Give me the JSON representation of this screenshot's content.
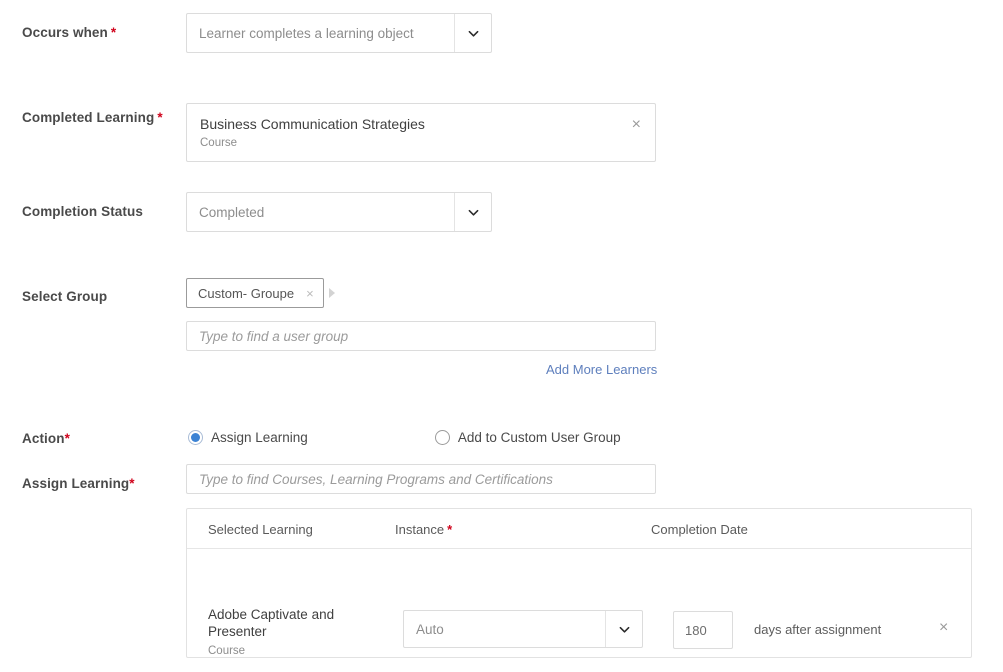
{
  "colors": {
    "required_asterisk": "#d0021b",
    "radio_selected": "#3b82d4",
    "link": "#5e7fbd",
    "label_text": "#4a4a4a",
    "placeholder_text": "#9b9b9b",
    "border": "#dcdcdc"
  },
  "fields": {
    "occurs_when": {
      "label": "Occurs when",
      "required_mark": "*",
      "value": "Learner completes a learning object"
    },
    "completed_learning": {
      "label": "Completed Learning",
      "required_mark": "*",
      "item_title": "Business Communication Strategies",
      "item_type": "Course",
      "remove_label": "×"
    },
    "completion_status": {
      "label": "Completion Status",
      "value": "Completed"
    },
    "select_group": {
      "label": "Select Group",
      "chip_label": "Custom- Groupe",
      "chip_remove_label": "×",
      "search_placeholder": "Type to find a user group",
      "add_more_link": "Add More Learners"
    },
    "action": {
      "label": "Action",
      "required_mark": "*",
      "options": [
        {
          "label": "Assign Learning",
          "selected": true
        },
        {
          "label": "Add to Custom User Group",
          "selected": false
        }
      ]
    },
    "assign_learning": {
      "label": "Assign Learning",
      "required_mark": "*",
      "search_placeholder": "Type to find Courses, Learning Programs and Certifications"
    }
  },
  "table": {
    "headers": [
      {
        "label": "Selected Learning",
        "required_mark": ""
      },
      {
        "label": "Instance",
        "required_mark": "*"
      },
      {
        "label": "Completion Date",
        "required_mark": ""
      }
    ],
    "rows": [
      {
        "learning_title": "Adobe Captivate and Presenter",
        "learning_type": "Course",
        "instance_value": "Auto",
        "completion_days": "180",
        "completion_suffix": "days after assignment",
        "remove_label": "×"
      }
    ]
  }
}
